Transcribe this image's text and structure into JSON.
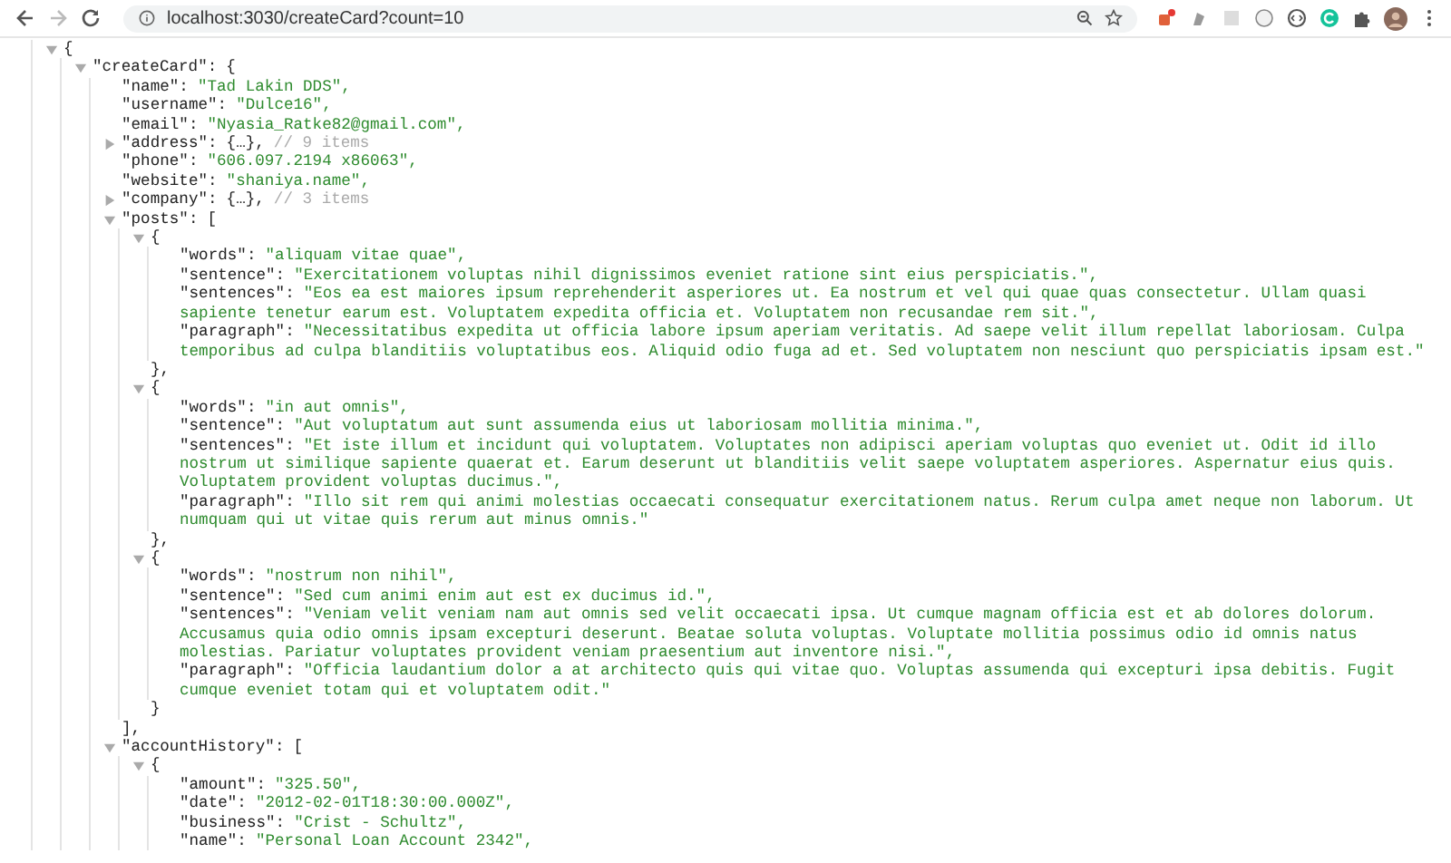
{
  "browser": {
    "url": "localhost:3030/createCard?count=10"
  },
  "tree": [
    {
      "kind": "container",
      "open": "{",
      "expanded": true,
      "children": [
        {
          "kind": "container",
          "key": "\"createCard\":",
          "open": "{",
          "expanded": true,
          "children": [
            {
              "kind": "value",
              "key": "\"name\":",
              "value": "\"Tad Lakin DDS\","
            },
            {
              "kind": "value",
              "key": "\"username\":",
              "value": "\"Dulce16\","
            },
            {
              "kind": "value",
              "key": "\"email\":",
              "value": "\"Nyasia_Ratke82@gmail.com\","
            },
            {
              "kind": "container",
              "key": "\"address\":",
              "summary": "{…},",
              "comment": "// 9 items",
              "expanded": false
            },
            {
              "kind": "value",
              "key": "\"phone\":",
              "value": "\"606.097.2194 x86063\","
            },
            {
              "kind": "value",
              "key": "\"website\":",
              "value": "\"shaniya.name\","
            },
            {
              "kind": "container",
              "key": "\"company\":",
              "summary": "{…},",
              "comment": "// 3 items",
              "expanded": false
            },
            {
              "kind": "container",
              "key": "\"posts\":",
              "open": "[",
              "expanded": true,
              "close": "],",
              "children": [
                {
                  "kind": "container",
                  "open": "{",
                  "expanded": true,
                  "close": "},",
                  "children": [
                    {
                      "kind": "value",
                      "key": "\"words\":",
                      "value": "\"aliquam vitae quae\","
                    },
                    {
                      "kind": "value",
                      "key": "\"sentence\":",
                      "value": "\"Exercitationem voluptas nihil dignissimos eveniet ratione sint eius perspiciatis.\","
                    },
                    {
                      "kind": "value",
                      "key": "\"sentences\":",
                      "value": "\"Eos ea est maiores ipsum reprehenderit asperiores ut. Ea nostrum et vel qui quae quas consectetur. Ullam quasi sapiente tenetur earum est. Voluptatem expedita officia et. Voluptatem non recusandae rem sit.\","
                    },
                    {
                      "kind": "value",
                      "key": "\"paragraph\":",
                      "value": "\"Necessitatibus expedita ut officia labore ipsum aperiam veritatis. Ad saepe velit illum repellat laboriosam. Culpa temporibus ad culpa blanditiis voluptatibus eos. Aliquid odio fuga ad et. Sed voluptatem non nesciunt quo perspiciatis ipsam est.\""
                    }
                  ]
                },
                {
                  "kind": "container",
                  "open": "{",
                  "expanded": true,
                  "close": "},",
                  "children": [
                    {
                      "kind": "value",
                      "key": "\"words\":",
                      "value": "\"in aut omnis\","
                    },
                    {
                      "kind": "value",
                      "key": "\"sentence\":",
                      "value": "\"Aut voluptatum aut sunt assumenda eius ut laboriosam mollitia minima.\","
                    },
                    {
                      "kind": "value",
                      "key": "\"sentences\":",
                      "value": "\"Et iste illum et incidunt qui voluptatem. Voluptates non adipisci aperiam voluptas quo eveniet ut. Odit id illo nostrum ut similique sapiente quaerat et. Earum deserunt ut blanditiis velit saepe voluptatem asperiores. Aspernatur eius quis. Voluptatem provident voluptas ducimus.\","
                    },
                    {
                      "kind": "value",
                      "key": "\"paragraph\":",
                      "value": "\"Illo sit rem qui animi molestias occaecati consequatur exercitationem natus. Rerum culpa amet neque non laborum. Ut numquam qui ut vitae quis rerum aut minus omnis.\""
                    }
                  ]
                },
                {
                  "kind": "container",
                  "open": "{",
                  "expanded": true,
                  "close": "}",
                  "children": [
                    {
                      "kind": "value",
                      "key": "\"words\":",
                      "value": "\"nostrum non nihil\","
                    },
                    {
                      "kind": "value",
                      "key": "\"sentence\":",
                      "value": "\"Sed cum animi enim aut est ex ducimus id.\","
                    },
                    {
                      "kind": "value",
                      "key": "\"sentences\":",
                      "value": "\"Veniam velit veniam nam aut omnis sed velit occaecati ipsa. Ut cumque magnam officia est et ab dolores dolorum. Accusamus quia odio omnis ipsam excepturi deserunt. Beatae soluta voluptas. Voluptate mollitia possimus odio id omnis natus molestias. Pariatur voluptates provident veniam praesentium aut inventore nisi.\","
                    },
                    {
                      "kind": "value",
                      "key": "\"paragraph\":",
                      "value": "\"Officia laudantium dolor a at architecto quis qui vitae quo. Voluptas assumenda qui excepturi ipsa debitis. Fugit cumque eveniet totam qui et voluptatem odit.\""
                    }
                  ]
                }
              ]
            },
            {
              "kind": "container",
              "key": "\"accountHistory\":",
              "open": "[",
              "expanded": true,
              "children": [
                {
                  "kind": "container",
                  "open": "{",
                  "expanded": true,
                  "children": [
                    {
                      "kind": "value",
                      "key": "\"amount\":",
                      "value": "\"325.50\","
                    },
                    {
                      "kind": "value",
                      "key": "\"date\":",
                      "value": "\"2012-02-01T18:30:00.000Z\","
                    },
                    {
                      "kind": "value",
                      "key": "\"business\":",
                      "value": "\"Crist - Schultz\","
                    },
                    {
                      "kind": "value",
                      "key": "\"name\":",
                      "value": "\"Personal Loan Account 2342\","
                    }
                  ]
                }
              ]
            }
          ]
        }
      ]
    }
  ]
}
